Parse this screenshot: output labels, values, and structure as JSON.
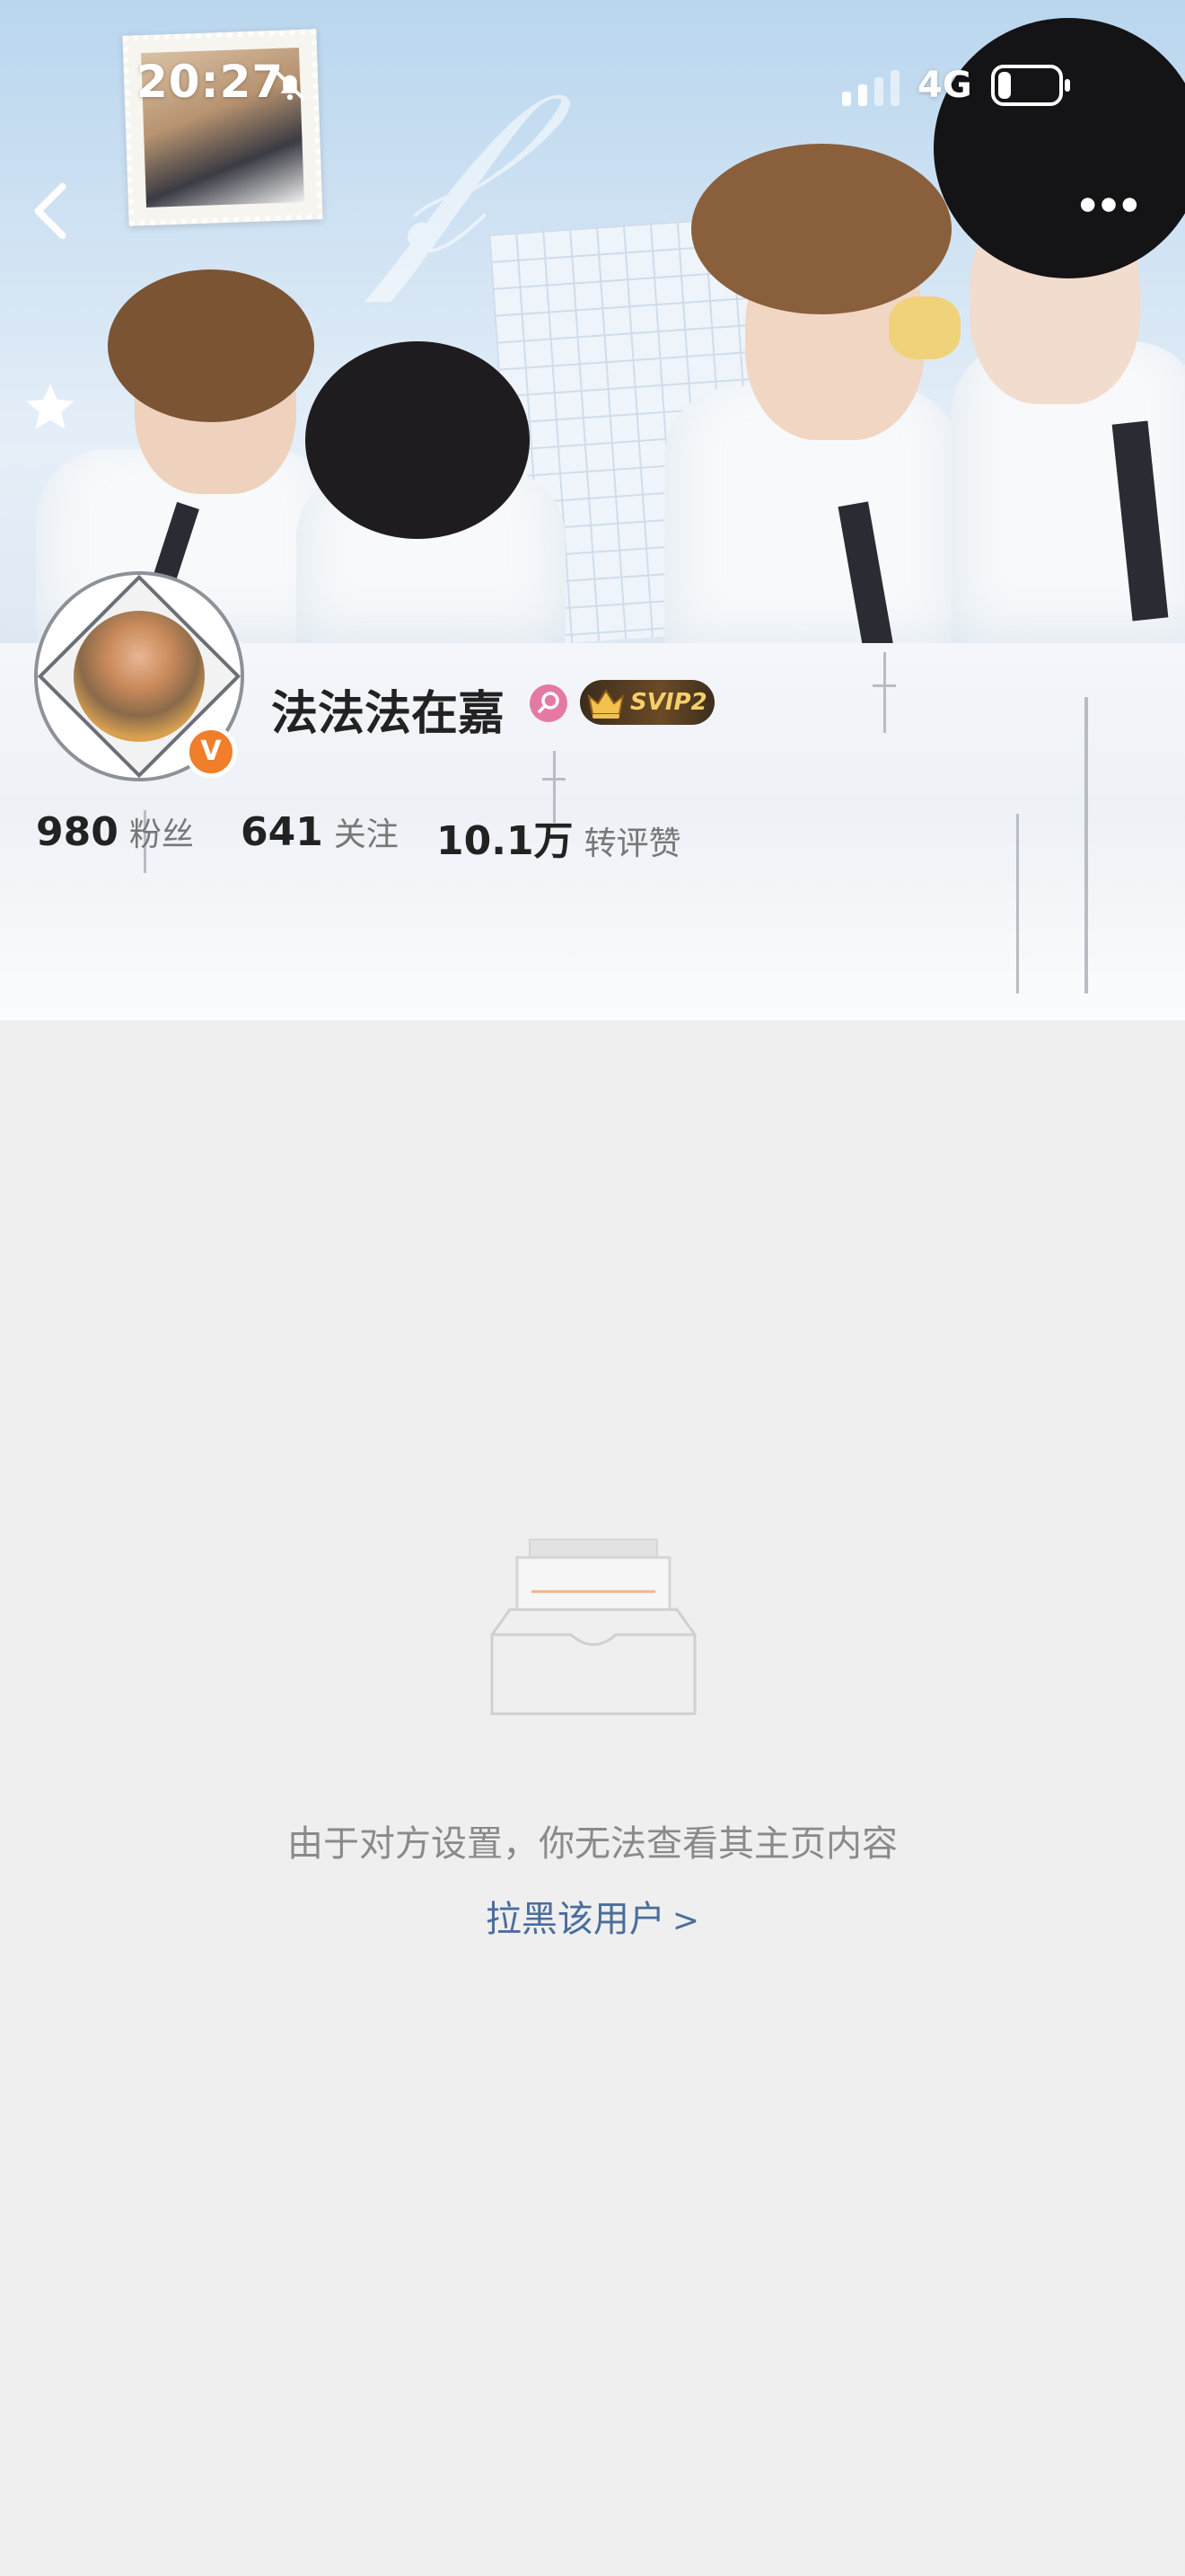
{
  "status_bar": {
    "time": "20:27",
    "network": "4G",
    "icons": [
      "bell-off-icon",
      "signal-icon",
      "battery-icon"
    ]
  },
  "nav": {
    "back_icon": "chevron-left-icon",
    "more_icon": "more-icon"
  },
  "profile": {
    "username": "法法法在嘉",
    "gender": "female",
    "vip_badge": "SVIP2",
    "verified": "V"
  },
  "stats": [
    {
      "value": "980",
      "label": "粉丝"
    },
    {
      "value": "641",
      "label": "关注"
    },
    {
      "value": "10.1万",
      "label": "转评赞"
    }
  ],
  "empty_state": {
    "icon": "empty-inbox-icon",
    "message": "由于对方设置，你无法查看其主页内容",
    "action": "拉黑该用户",
    "action_chevron": ">"
  },
  "colors": {
    "background": "#efefef",
    "accent_link": "#4a6d9c",
    "verified": "#f07e2a",
    "gender_female": "#e47aa3"
  }
}
